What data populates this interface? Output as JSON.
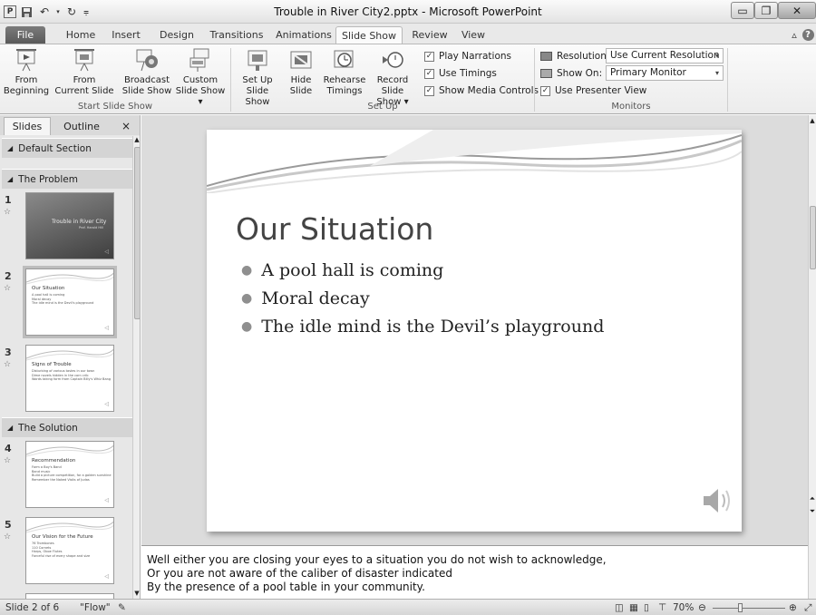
{
  "window": {
    "title": "Trouble in River City2.pptx - Microsoft PowerPoint"
  },
  "tabs": [
    "File",
    "Home",
    "Insert",
    "Design",
    "Transitions",
    "Animations",
    "Slide Show",
    "Review",
    "View"
  ],
  "active_tab": "Slide Show",
  "ribbon": {
    "start_group": {
      "label": "Start Slide Show",
      "buttons": [
        {
          "line1": "From",
          "line2": "Beginning"
        },
        {
          "line1": "From",
          "line2": "Current Slide"
        },
        {
          "line1": "Broadcast",
          "line2": "Slide Show"
        },
        {
          "line1": "Custom",
          "line2": "Slide Show ▾"
        }
      ]
    },
    "setup_group": {
      "label": "Set Up",
      "buttons": [
        {
          "line1": "Set Up",
          "line2": "Slide Show"
        },
        {
          "line1": "Hide",
          "line2": "Slide"
        },
        {
          "line1": "Rehearse",
          "line2": "Timings"
        },
        {
          "line1": "Record Slide",
          "line2": "Show ▾"
        }
      ],
      "checkboxes": [
        {
          "label": "Play Narrations",
          "checked": true
        },
        {
          "label": "Use Timings",
          "checked": true
        },
        {
          "label": "Show Media Controls",
          "checked": true
        }
      ]
    },
    "monitors_group": {
      "label": "Monitors",
      "resolution_label": "Resolution:",
      "resolution_value": "Use Current Resolution",
      "show_on_label": "Show On:",
      "show_on_value": "Primary Monitor",
      "presenter_view_label": "Use Presenter View",
      "presenter_view_checked": true
    }
  },
  "left_pane": {
    "tabs": [
      "Slides",
      "Outline"
    ],
    "close": "×",
    "sections": [
      "Default Section",
      "The Problem",
      "The Solution"
    ],
    "thumbnails": [
      {
        "num": "1",
        "title": "Trouble in River City",
        "subtitle": "Prof. Harold Hill",
        "bullets": []
      },
      {
        "num": "2",
        "title": "Our Situation",
        "bullets": [
          "A pool hall is coming",
          "Moral decay",
          "The idle mind is the Devil's playground"
        ]
      },
      {
        "num": "3",
        "title": "Signs of Trouble",
        "bullets": [
          "Disturbing of various tastes in our town",
          "Dime novels hidden in the corn crib",
          "Words taking form from Captain Billy's Whiz Bang"
        ]
      },
      {
        "num": "4",
        "title": "Recommendation",
        "bullets": [
          "Form a Boy's Band",
          "Band music",
          "Build a picture competition, for a golden sunshine",
          "Remember the Naked Visits of Judas"
        ]
      },
      {
        "num": "5",
        "title": "Our Vision for the Future",
        "bullets": [
          "76 Trombones",
          "110 Cornets",
          "Harps, Oboe Flutes",
          "Forceful rise of every shape and size"
        ]
      }
    ]
  },
  "slide": {
    "title": "Our Situation",
    "bullets": [
      "A pool hall is coming",
      "Moral decay",
      "The idle mind is the Devil’s playground"
    ]
  },
  "notes": {
    "lines": [
      "Well either you are closing your eyes to a situation you do not wish to acknowledge,",
      "Or you are not aware of the caliber of disaster indicated",
      "By the presence of a pool table in your community."
    ]
  },
  "statusbar": {
    "slide_info": "Slide 2 of 6",
    "theme": "\"Flow\"",
    "zoom": "70%"
  },
  "colors": {
    "ribbon_bg": "#f2f2f2",
    "editor_bg": "#dcdcdc",
    "file_tab": "#5f5f5f"
  }
}
